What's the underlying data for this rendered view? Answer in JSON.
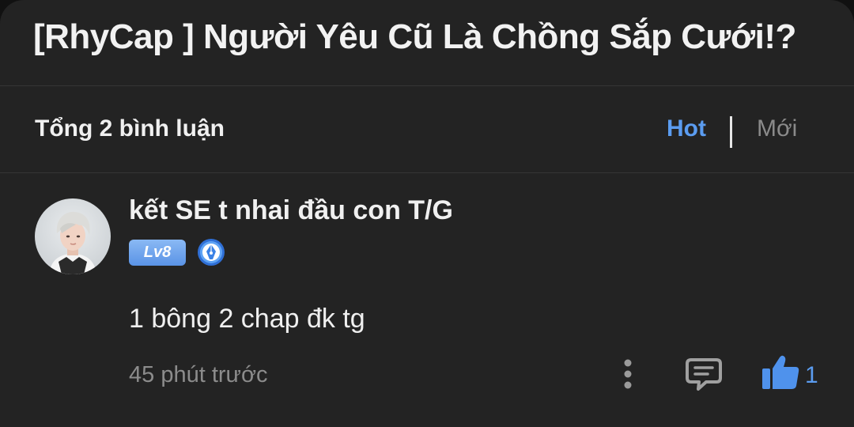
{
  "header": {
    "title": "[RhyCap ] Người Yêu Cũ Là Chồng Sắp Cưới!?"
  },
  "toolbar": {
    "comment_count": "Tổng 2 bình luận",
    "sort_hot": "Hot",
    "sort_new": "Mới"
  },
  "comments": [
    {
      "username": "kết SE t nhai đầu con T/G",
      "level": "Lv8",
      "text": "1 bông 2 chap đk tg",
      "time": "45 phút trước",
      "likes": "1"
    }
  ],
  "icons": {
    "badge": "fountain-pen-badge-icon",
    "more": "more-vertical-icon",
    "reply": "comment-reply-icon",
    "like": "thumbs-up-icon"
  },
  "colors": {
    "background": "#232323",
    "accent": "#5b9cf0",
    "text": "#f0f0f0",
    "muted": "#8c8c8c"
  }
}
